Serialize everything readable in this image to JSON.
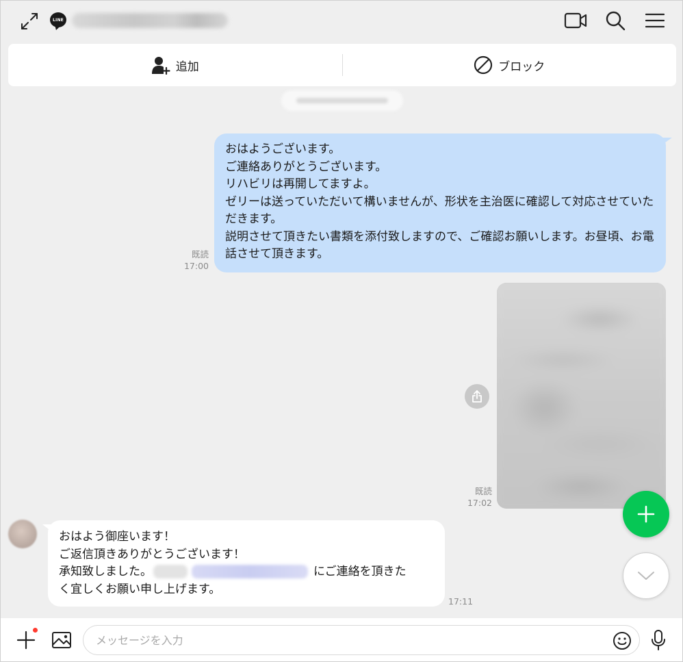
{
  "colors": {
    "background": "#efefef",
    "outgoing_bubble": "#c6dffb",
    "incoming_bubble": "#ffffff",
    "fab_green": "#06c755",
    "notify_dot": "#ff3b30"
  },
  "header": {
    "logo_text": "LINE",
    "icons": [
      "expand-icon",
      "video-call-icon",
      "search-icon",
      "menu-icon"
    ]
  },
  "actions": {
    "add_label": "追加",
    "block_label": "ブロック"
  },
  "messages": {
    "outgoing_text": "おはようございます。\nご連絡ありがとうございます。\nリハビリは再開してますよ。\nゼリーは送っていただいて構いませんが、形状を主治医に確認して対応させていただきます。\n説明させて頂きたい書類を添付致しますので、ご確認お願いします。お昼頃、お電話させて頂きます。",
    "outgoing_read": "既読",
    "outgoing_time": "17:00",
    "image_read": "既読",
    "image_time": "17:02",
    "incoming_line1": "おはよう御座います！",
    "incoming_line2": "ご返信頂きありがとうございます！",
    "incoming_line3_before": "承知致しました。",
    "incoming_line3_after": "にご連絡を頂きた",
    "incoming_line4": "く宜しくお願い申し上げます。",
    "incoming_time": "17:11"
  },
  "composer": {
    "placeholder": "メッセージを入力"
  }
}
